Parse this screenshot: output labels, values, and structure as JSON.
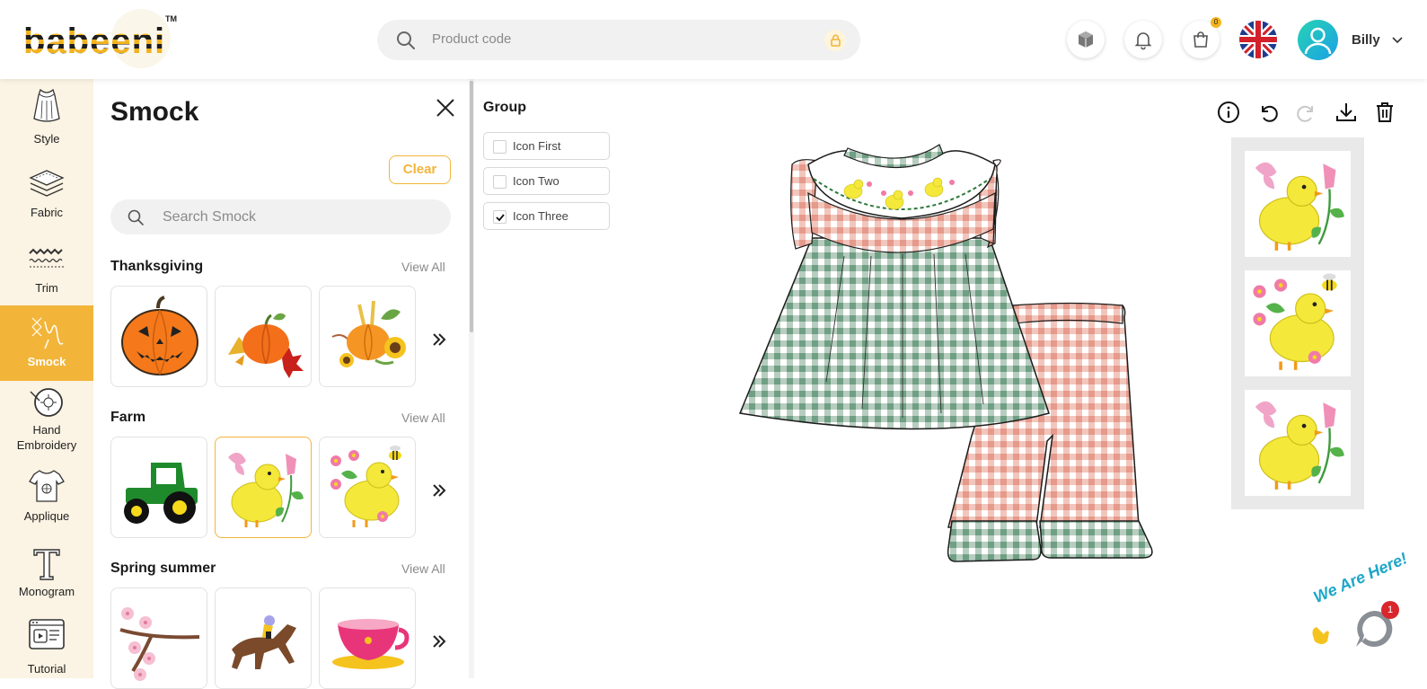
{
  "header": {
    "logo_text": "babeeni",
    "logo_tm": "TM",
    "search_placeholder": "Product code",
    "cart_count": "0",
    "user_name": "Billy"
  },
  "nav": [
    {
      "label": "Style",
      "icon": "dress-icon"
    },
    {
      "label": "Fabric",
      "icon": "fabric-icon"
    },
    {
      "label": "Trim",
      "icon": "trim-icon"
    },
    {
      "label": "Smock",
      "icon": "smock-icon",
      "active": true
    },
    {
      "label": "Hand\nEmbroidery",
      "icon": "hand-embroidery-icon"
    },
    {
      "label": "Applique",
      "icon": "applique-icon"
    },
    {
      "label": "Monogram",
      "icon": "monogram-icon"
    },
    {
      "label": "Tutorial",
      "icon": "tutorial-icon"
    }
  ],
  "panel": {
    "title": "Smock",
    "clear_label": "Clear",
    "search_placeholder": "Search Smock",
    "categories": [
      {
        "name": "Thanksgiving",
        "view_all": "View All",
        "items": [
          "pumpkin-jack-o-lantern",
          "pumpkin-leaves",
          "pumpkin-sunflowers"
        ]
      },
      {
        "name": "Farm",
        "view_all": "View All",
        "items": [
          "green-tractor",
          "chick-butterfly",
          "chick-bee-flowers"
        ]
      },
      {
        "name": "Spring summer",
        "view_all": "View All",
        "items": [
          "cherry-blossom-branch",
          "racing-horse",
          "teacup"
        ]
      }
    ]
  },
  "group": {
    "title": "Group",
    "options": [
      {
        "label": "Icon First",
        "checked": false
      },
      {
        "label": "Icon Two",
        "checked": false
      },
      {
        "label": "Icon Three",
        "checked": true
      }
    ]
  },
  "toolbar": [
    "info-icon",
    "undo-icon",
    "redo-icon",
    "download-icon",
    "trash-icon"
  ],
  "thumbnails": [
    "chick-butterfly",
    "chick-bee-flowers",
    "chick-butterfly"
  ],
  "chat": {
    "label": "We Are Here!",
    "badge": "1"
  },
  "colors": {
    "accent": "#f2b53a",
    "nav_bg": "#fbf3e3",
    "gingham_green": "#6f9f84",
    "gingham_pink": "#e59a8c"
  }
}
